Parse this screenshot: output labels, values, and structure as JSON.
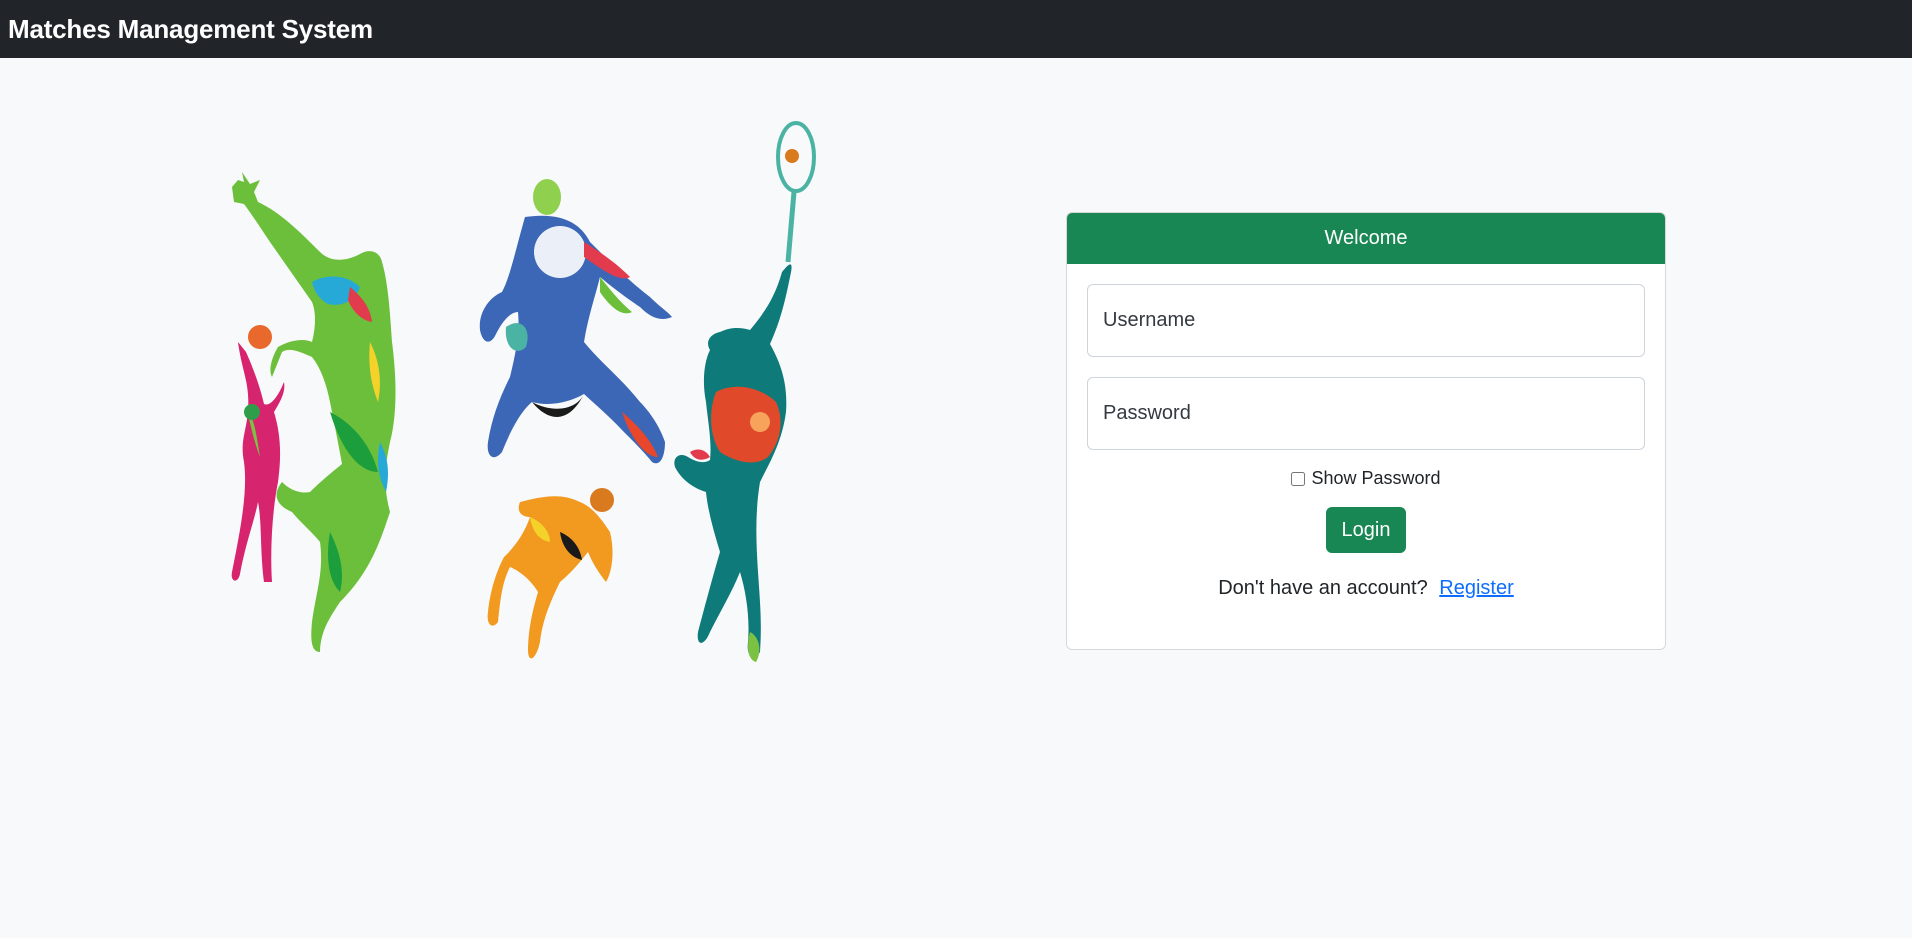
{
  "navbar": {
    "brand": "Matches Management System"
  },
  "hero": {
    "image": "colorful-athletes-illustration"
  },
  "login_card": {
    "header": "Welcome",
    "username_placeholder": "Username",
    "password_placeholder": "Password",
    "show_password_label": "Show Password",
    "show_password_checked": false,
    "login_button": "Login",
    "register_prompt": "Don't have an account?",
    "register_link": "Register"
  },
  "colors": {
    "navbar": "#212529",
    "accent": "#198754",
    "link": "#0d6efd",
    "background": "#f8f9fa"
  }
}
